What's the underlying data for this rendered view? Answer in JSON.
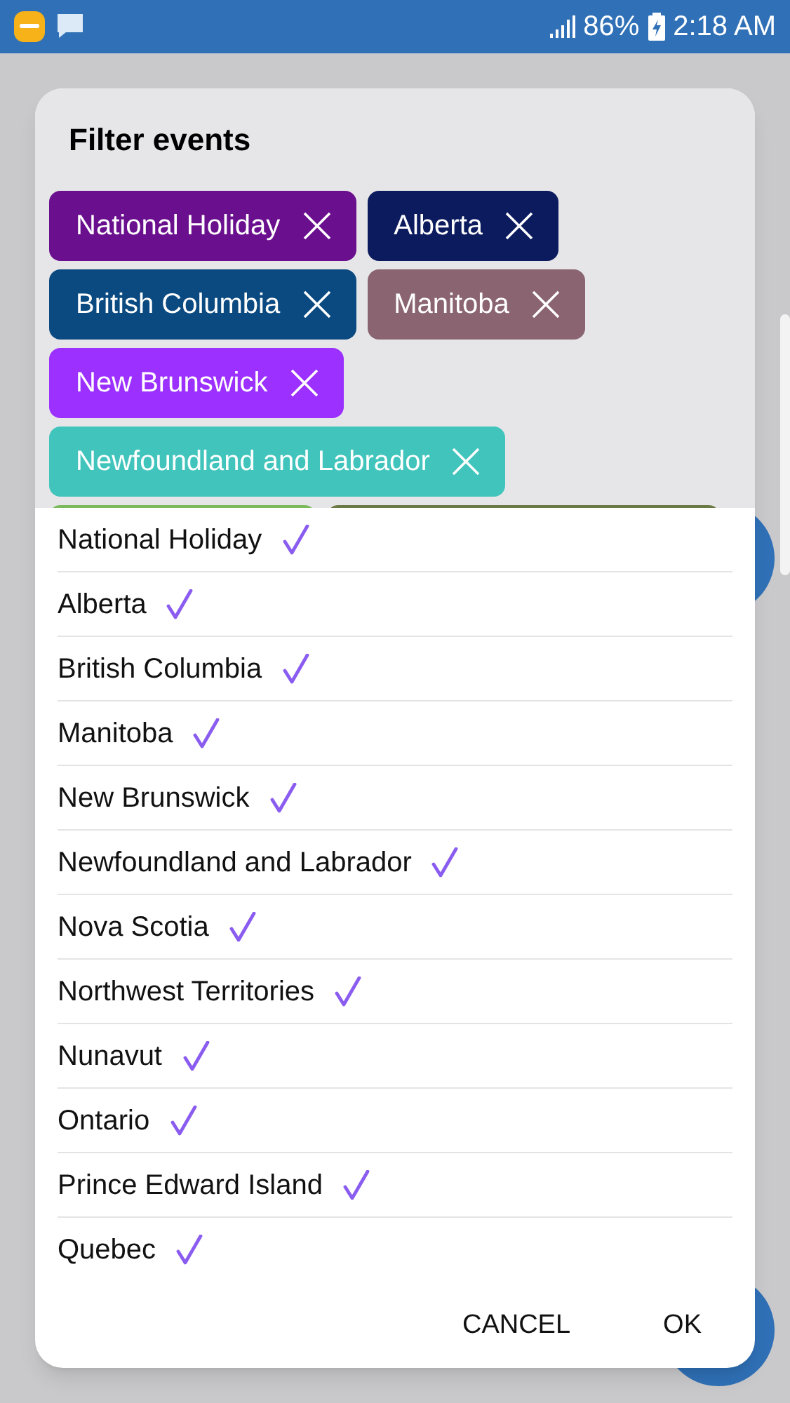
{
  "status_bar": {
    "battery": "86%",
    "time": "2:18 AM"
  },
  "dialog": {
    "title": "Filter events",
    "chips": [
      {
        "label": "National Holiday",
        "color": "#6a0f8e"
      },
      {
        "label": "Alberta",
        "color": "#0b1b5e"
      },
      {
        "label": "British Columbia",
        "color": "#0b4a80"
      },
      {
        "label": "Manitoba",
        "color": "#8a6470"
      },
      {
        "label": "New Brunswick",
        "color": "#9b30ff"
      },
      {
        "label": "Newfoundland and Labrador",
        "color": "#40c4bc"
      },
      {
        "color": "#7cb95a"
      },
      {
        "color": "#6b7a45"
      }
    ],
    "options": [
      {
        "label": "National Holiday",
        "checked": true
      },
      {
        "label": "Alberta",
        "checked": true
      },
      {
        "label": "British Columbia",
        "checked": true
      },
      {
        "label": "Manitoba",
        "checked": true
      },
      {
        "label": "New Brunswick",
        "checked": true
      },
      {
        "label": "Newfoundland and Labrador",
        "checked": true
      },
      {
        "label": "Nova Scotia",
        "checked": true
      },
      {
        "label": "Northwest Territories",
        "checked": true
      },
      {
        "label": "Nunavut",
        "checked": true
      },
      {
        "label": "Ontario",
        "checked": true
      },
      {
        "label": "Prince Edward Island",
        "checked": true
      },
      {
        "label": "Quebec",
        "checked": true
      }
    ],
    "buttons": [
      "CANCEL",
      "OK"
    ]
  }
}
